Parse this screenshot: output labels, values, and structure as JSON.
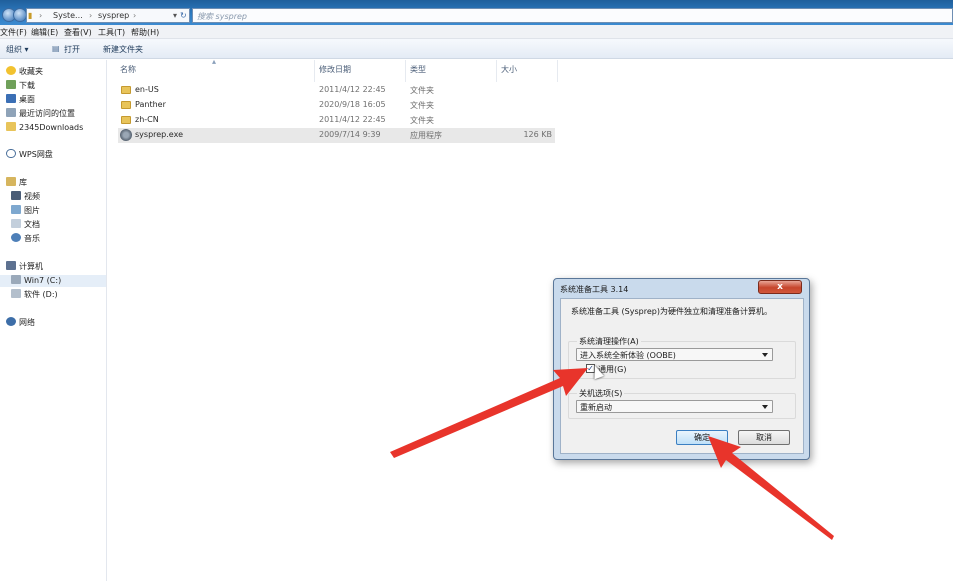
{
  "address": {
    "crumb1": "Syste...",
    "crumb2": "sysprep",
    "search_placeholder": "搜索 sysprep"
  },
  "menu": [
    "文件(F)",
    "编辑(E)",
    "查看(V)",
    "工具(T)",
    "帮助(H)"
  ],
  "toolbar": {
    "organize": "组织 ▾",
    "open": "打开",
    "new_folder": "新建文件夹"
  },
  "nav": {
    "favorites": "收藏夹",
    "downloads": "下载",
    "desktop": "桌面",
    "recent": "最近访问的位置",
    "downloads2345": "2345Downloads",
    "wps": "WPS网盘",
    "library": "库",
    "video": "视频",
    "pictures": "图片",
    "docs": "文档",
    "music": "音乐",
    "computer": "计算机",
    "win7": "Win7 (C:)",
    "software": "软件 (D:)",
    "network": "网络"
  },
  "columns": {
    "name": "名称",
    "date": "修改日期",
    "type": "类型",
    "size": "大小"
  },
  "files": [
    {
      "name": "en-US",
      "date": "2011/4/12 22:45",
      "type": "文件夹",
      "size": ""
    },
    {
      "name": "Panther",
      "date": "2020/9/18 16:05",
      "type": "文件夹",
      "size": ""
    },
    {
      "name": "zh-CN",
      "date": "2011/4/12 22:45",
      "type": "文件夹",
      "size": ""
    },
    {
      "name": "sysprep.exe",
      "date": "2009/7/14 9:39",
      "type": "应用程序",
      "size": "126 KB"
    }
  ],
  "dialog": {
    "title": "系统准备工具 3.14",
    "close": "x",
    "description": "系统准备工具 (Sysprep)为硬件独立和清理准备计算机。",
    "cleanup_label": "系统清理操作(A)",
    "cleanup_value": "进入系统全新体验 (OOBE)",
    "generalize_label": "通用(G)",
    "generalize_checked": true,
    "check_mark": "✓",
    "shutdown_label": "关机选项(S)",
    "shutdown_value": "重新启动",
    "ok": "确定",
    "cancel": "取消"
  },
  "colors": {
    "arrow": "#e8342b",
    "titlebar": "#2d7bc0"
  }
}
